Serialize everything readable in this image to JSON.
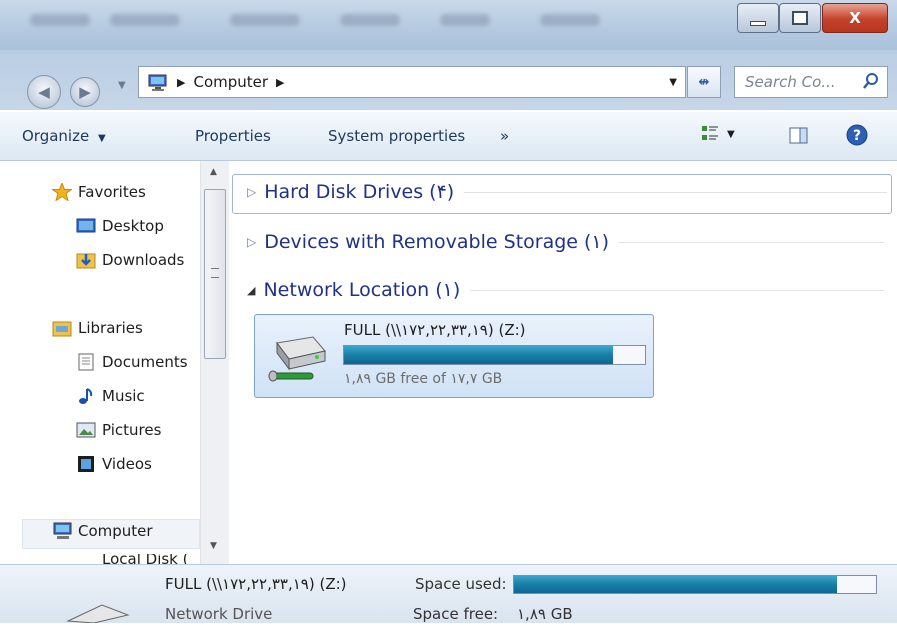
{
  "window": {
    "close_glyph": "X"
  },
  "address": {
    "segment": "Computer",
    "search_placeholder": "Search Co..."
  },
  "toolbar": {
    "organize": "Organize",
    "properties": "Properties",
    "system_properties": "System properties",
    "more": "»"
  },
  "sidebar": {
    "favorites": "Favorites",
    "desktop": "Desktop",
    "downloads": "Downloads",
    "libraries": "Libraries",
    "documents": "Documents",
    "music": "Music",
    "pictures": "Pictures",
    "videos": "Videos",
    "computer": "Computer",
    "local_disk_partial": "Local Disk ("
  },
  "groups": {
    "hard_disks": "Hard Disk Drives (۴)",
    "removable": "Devices with Removable Storage (۱)",
    "network": "Network Location (۱)"
  },
  "drive": {
    "name": "FULL (\\\\۱۷۲,۲۲,۳۳,۱۹) (Z:)",
    "free_text": "۱,۸۹ GB free of ۱۷,۷ GB",
    "used_fraction": 0.893
  },
  "details": {
    "name": "FULL (\\\\۱۷۲,۲۲,۳۳,۱۹) (Z:)",
    "type": "Network Drive",
    "space_used_label": "Space used:",
    "space_free_label": "Space free:",
    "space_free_value": "۱,۸۹ GB"
  },
  "colors": {
    "accent": "#1e3287",
    "bar": "#187fa6"
  }
}
